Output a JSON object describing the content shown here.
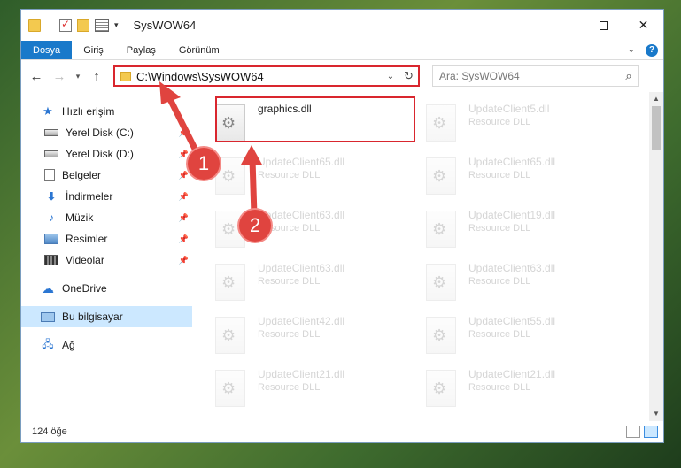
{
  "window": {
    "title": "SysWOW64"
  },
  "ribbon": {
    "tabs": [
      "Dosya",
      "Giriş",
      "Paylaş",
      "Görünüm"
    ],
    "help": "?"
  },
  "nav": {
    "address": "C:\\Windows\\SysWOW64",
    "search_placeholder": "Ara: SysWOW64"
  },
  "sidebar": {
    "items": [
      {
        "label": "Hızlı erişim",
        "icon": "star-icon"
      },
      {
        "label": "Yerel Disk (C:)",
        "icon": "drive-icon",
        "pinned": true
      },
      {
        "label": "Yerel Disk (D:)",
        "icon": "drive-icon",
        "pinned": true
      },
      {
        "label": "Belgeler",
        "icon": "document-icon",
        "pinned": true
      },
      {
        "label": "İndirmeler",
        "icon": "download-icon",
        "pinned": true
      },
      {
        "label": "Müzik",
        "icon": "music-icon",
        "pinned": true
      },
      {
        "label": "Resimler",
        "icon": "pictures-icon",
        "pinned": true
      },
      {
        "label": "Videolar",
        "icon": "video-icon",
        "pinned": true
      },
      {
        "label": "OneDrive",
        "icon": "cloud-icon"
      },
      {
        "label": "Bu bilgisayar",
        "icon": "computer-icon",
        "selected": true
      },
      {
        "label": "Ağ",
        "icon": "network-icon"
      }
    ]
  },
  "files": [
    {
      "name": "graphics.dll",
      "type": ""
    },
    {
      "name": "UpdateClient5.dll",
      "type": "Resource DLL"
    },
    {
      "name": "UpdateClient65.dll",
      "type": "Resource DLL"
    },
    {
      "name": "UpdateClient65.dll",
      "type": "Resource DLL"
    },
    {
      "name": "UpdateClient63.dll",
      "type": "Resource DLL"
    },
    {
      "name": "UpdateClient19.dll",
      "type": "Resource DLL"
    },
    {
      "name": "UpdateClient63.dll",
      "type": "Resource DLL"
    },
    {
      "name": "UpdateClient63.dll",
      "type": "Resource DLL"
    },
    {
      "name": "UpdateClient42.dll",
      "type": "Resource DLL"
    },
    {
      "name": "UpdateClient55.dll",
      "type": "Resource DLL"
    },
    {
      "name": "UpdateClient21.dll",
      "type": "Resource DLL"
    },
    {
      "name": "UpdateClient21.dll",
      "type": "Resource DLL"
    }
  ],
  "status": {
    "count": "124 öğe"
  },
  "annotations": {
    "badge1": "1",
    "badge2": "2",
    "color": "#e0443f"
  }
}
